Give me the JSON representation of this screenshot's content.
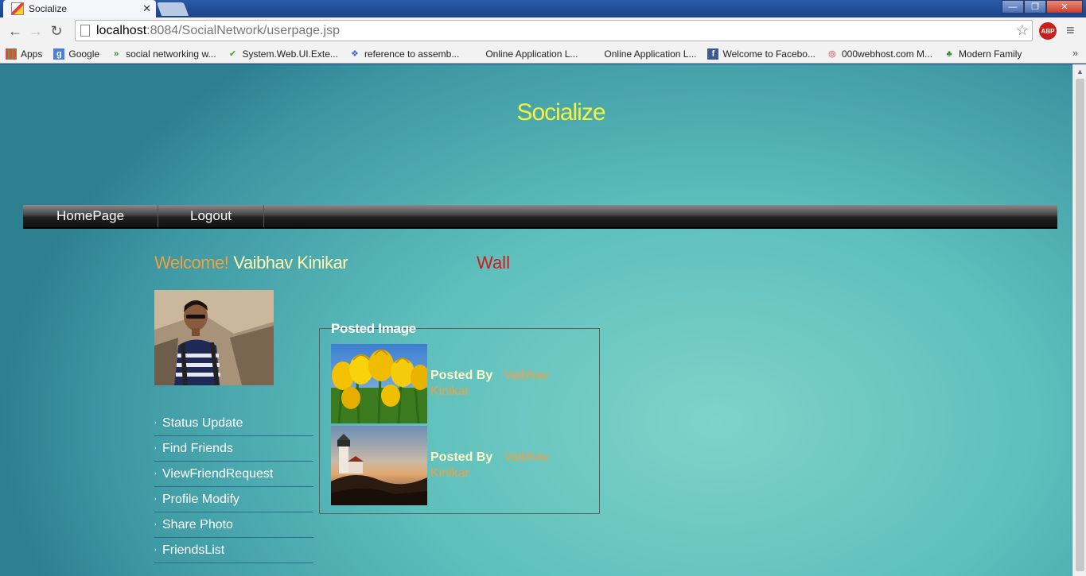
{
  "browser": {
    "tab_title": "Socialize",
    "tab_close": "✕",
    "url_host": "localhost",
    "url_path": ":8084/SocialNetwork/userpage.jsp",
    "icons": [
      "back-arrow-icon",
      "forward-arrow-icon",
      "reload-icon",
      "page-icon",
      "star-icon",
      "adblock-icon",
      "menu-icon"
    ],
    "abp_label": "ABP",
    "bookmarks": [
      {
        "label": "Apps",
        "icon": "apps-grid-icon"
      },
      {
        "label": "Google",
        "icon": "google-icon"
      },
      {
        "label": "social networking w...",
        "icon": "green-chevrons-icon"
      },
      {
        "label": "System.Web.UI.Exte...",
        "icon": "checkmark-icon"
      },
      {
        "label": "reference to assemb...",
        "icon": "dropbox-icon"
      },
      {
        "label": "Online Application L...",
        "icon": "blank-icon"
      },
      {
        "label": "Online Application L...",
        "icon": "blank-icon"
      },
      {
        "label": "Welcome to Facebo...",
        "icon": "facebook-icon"
      },
      {
        "label": "000webhost.com M...",
        "icon": "webhost-icon"
      },
      {
        "label": "Modern Family",
        "icon": "tree-icon"
      }
    ],
    "bookmarks_more": "»"
  },
  "site": {
    "title": "Socialize",
    "nav": {
      "home": "HomePage",
      "logout": "Logout"
    },
    "welcome_label": "Welcome!",
    "user_name": "Vaibhav Kinikar",
    "wall_label": "Wall",
    "side_menu": [
      "Status Update",
      "Find Friends",
      "ViewFriendRequest",
      "Profile Modify",
      "Share Photo",
      "FriendsList"
    ],
    "posted": {
      "legend": "Posted Image",
      "posts": [
        {
          "by_label": "Posted By",
          "author": "Vaibhav Kinikar",
          "image": "yellow-tulips"
        },
        {
          "by_label": "Posted By",
          "author": "Vaibhav Kinikar",
          "image": "lighthouse-sunset"
        }
      ]
    }
  },
  "colors": {
    "title": "#f5f23c",
    "welcome": "#f0a040",
    "name": "#fff9b0",
    "wall": "#d81818",
    "accent_bg": "#5ebfbc"
  }
}
